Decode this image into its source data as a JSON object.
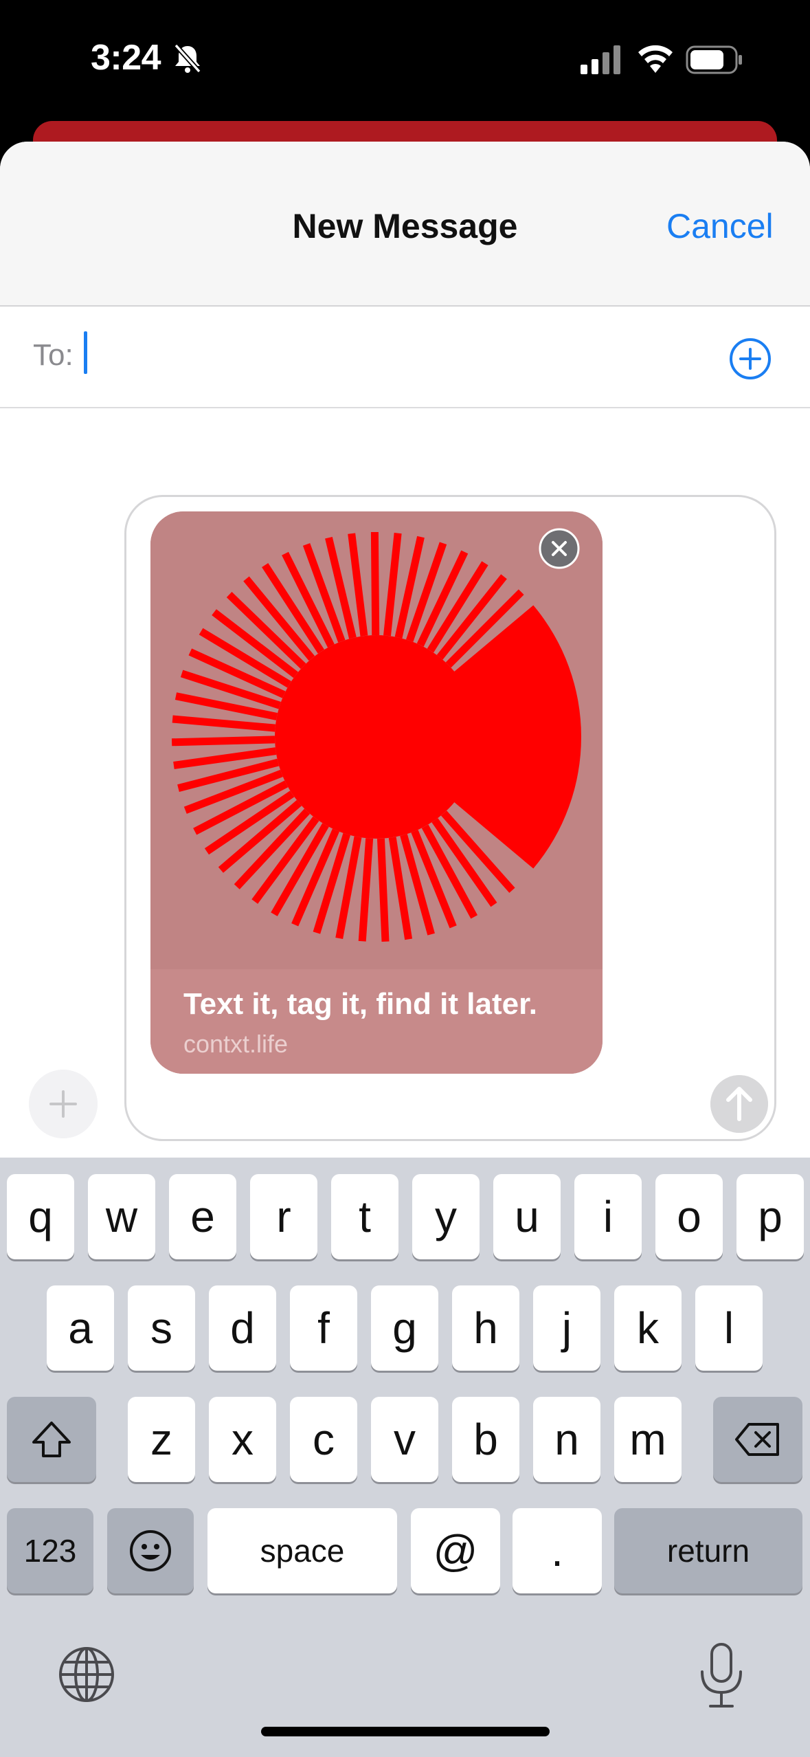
{
  "status_bar": {
    "time": "3:24"
  },
  "header": {
    "title": "New Message",
    "cancel_label": "Cancel"
  },
  "recipient": {
    "label": "To:",
    "value": ""
  },
  "link_preview": {
    "title": "Text it, tag it, find it later.",
    "domain": "contxt.life"
  },
  "keyboard": {
    "row1": [
      "q",
      "w",
      "e",
      "r",
      "t",
      "y",
      "u",
      "i",
      "o",
      "p"
    ],
    "row2": [
      "a",
      "s",
      "d",
      "f",
      "g",
      "h",
      "j",
      "k",
      "l"
    ],
    "row3": [
      "z",
      "x",
      "c",
      "v",
      "b",
      "n",
      "m"
    ],
    "numbers_label": "123",
    "space_label": "space",
    "at_label": "@",
    "period_label": ".",
    "return_label": "return"
  },
  "colors": {
    "accent": "#1a7ef2",
    "card_bg": "#c08484",
    "logo_red": "#ff0000"
  },
  "icons": [
    "bell-slash-icon",
    "signal-icon",
    "wifi-icon",
    "battery-icon",
    "plus-circle-icon",
    "close-circle-icon",
    "plus-icon",
    "arrow-up-icon",
    "shift-icon",
    "backspace-icon",
    "emoji-icon",
    "globe-icon",
    "microphone-icon"
  ]
}
